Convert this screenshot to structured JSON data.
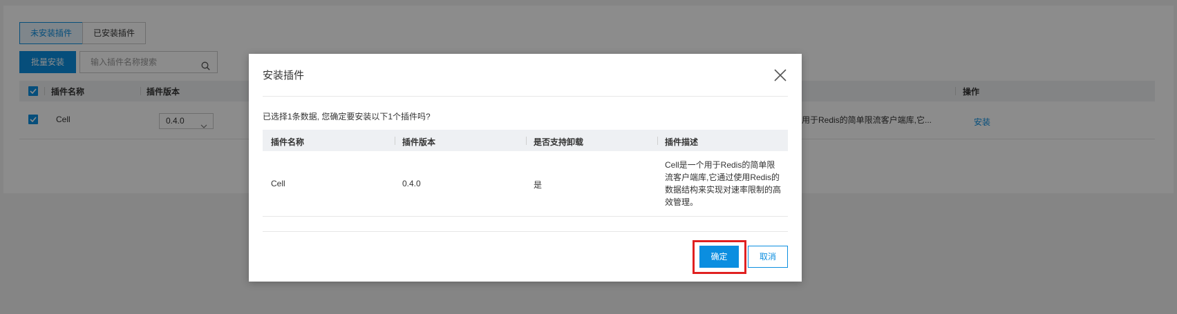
{
  "background": {
    "tabs": [
      {
        "label": "未安装插件",
        "active": true
      },
      {
        "label": "已安装插件",
        "active": false
      }
    ],
    "batch_install_label": "批量安装",
    "search_placeholder": "输入插件名称搜索",
    "table": {
      "columns": [
        "插件名称",
        "插件版本",
        "操作"
      ],
      "row": {
        "name": "Cell",
        "version": "0.4.0",
        "description_snippet": "用于Redis的简单限流客户端库,它...",
        "action": "安装"
      }
    }
  },
  "modal": {
    "title": "安装插件",
    "confirm_text": "已选择1条数据, 您确定要安装以下1个插件吗?",
    "columns": [
      "插件名称",
      "插件版本",
      "是否支持卸载",
      "插件描述"
    ],
    "rows": [
      {
        "name": "Cell",
        "version": "0.4.0",
        "uninstallable": "是",
        "description": "Cell是一个用于Redis的简单限流客户端库,它通过使用Redis的数据结构来实现对速率限制的高效管理。"
      }
    ],
    "confirm_label": "确定",
    "cancel_label": "取消"
  },
  "colors": {
    "primary": "#0b8ee0",
    "highlight": "#e02020",
    "header_bg": "#eef0f3"
  }
}
